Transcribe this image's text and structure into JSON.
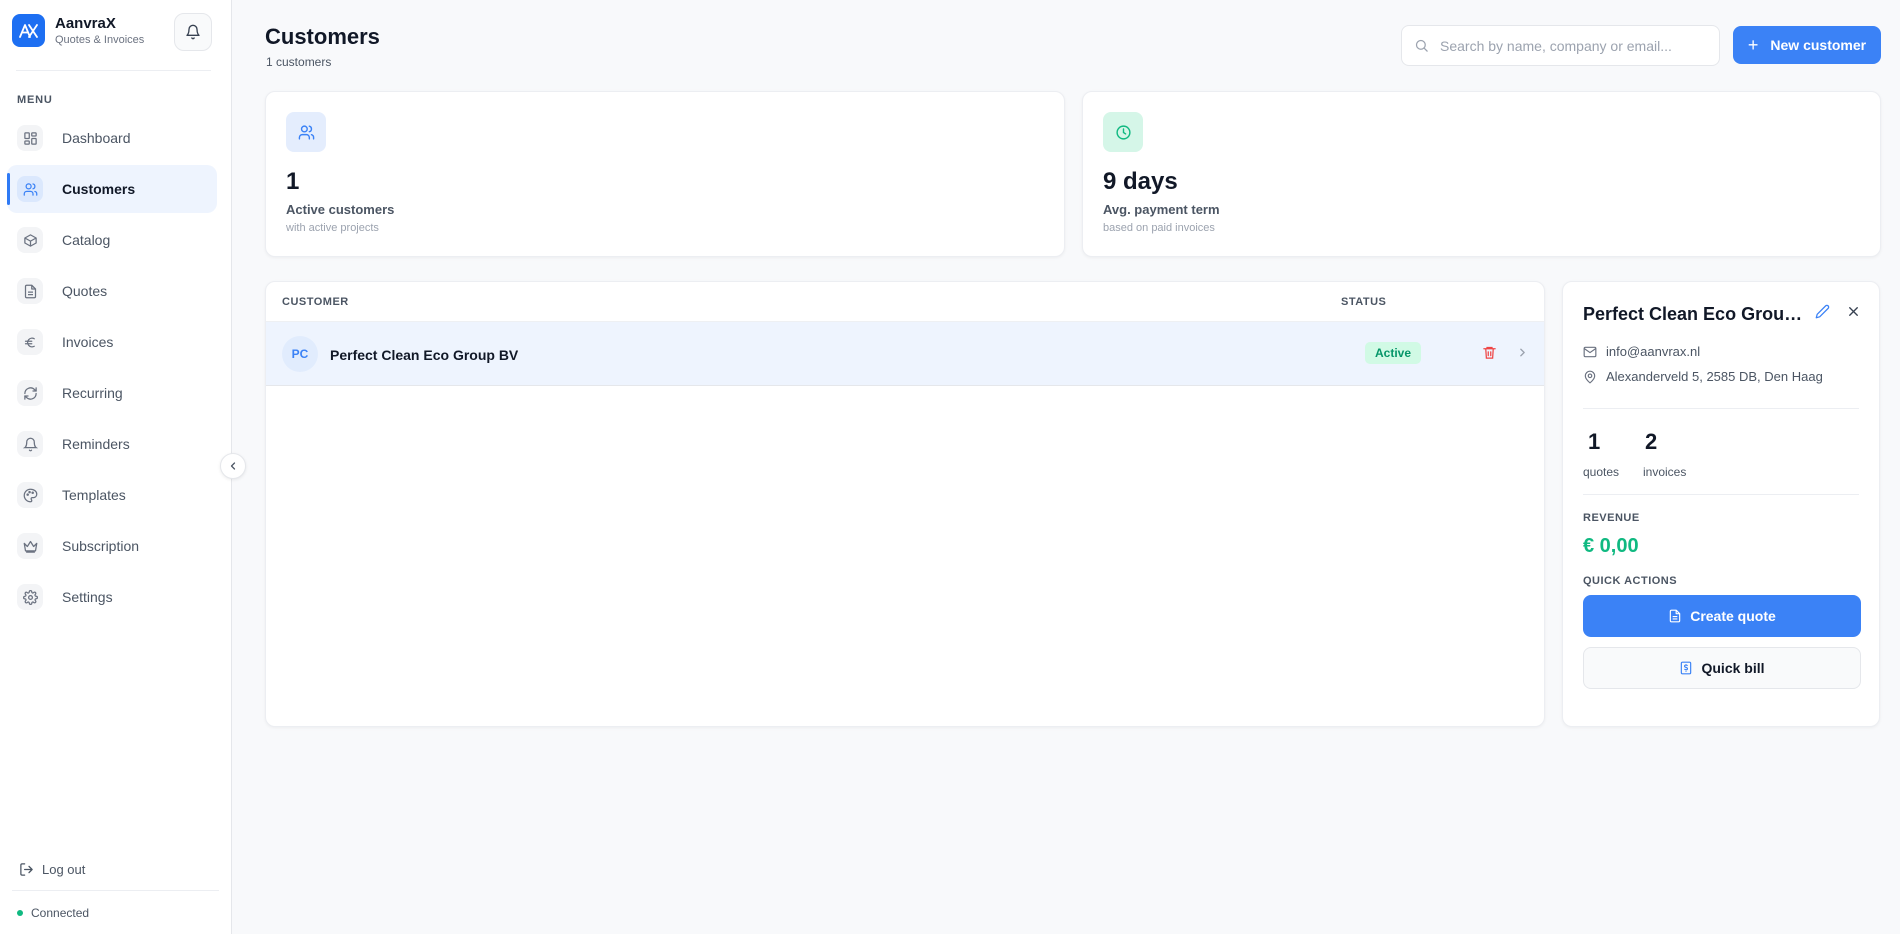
{
  "app": {
    "name": "AanvraX",
    "subtitle": "Quotes & Invoices"
  },
  "colors": {
    "accent": "#3b82f6",
    "success": "#10b981",
    "danger": "#ef4444",
    "active_bg": "#eef4fe"
  },
  "sidebar": {
    "menu_label": "MENU",
    "items": [
      {
        "label": "Dashboard",
        "icon": "dashboard-icon"
      },
      {
        "label": "Customers",
        "icon": "users-icon",
        "active": true
      },
      {
        "label": "Catalog",
        "icon": "box-icon"
      },
      {
        "label": "Quotes",
        "icon": "document-icon"
      },
      {
        "label": "Invoices",
        "icon": "euro-icon"
      },
      {
        "label": "Recurring",
        "icon": "refresh-icon"
      },
      {
        "label": "Reminders",
        "icon": "bell-icon"
      },
      {
        "label": "Templates",
        "icon": "palette-icon"
      },
      {
        "label": "Subscription",
        "icon": "crown-icon"
      },
      {
        "label": "Settings",
        "icon": "gear-icon"
      }
    ],
    "logout_label": "Log out",
    "status_label": "Connected"
  },
  "header": {
    "title": "Customers",
    "subtitle": "1 customers",
    "search_placeholder": "Search by name, company or email...",
    "new_button_label": "New customer"
  },
  "stats": [
    {
      "value": "1",
      "label": "Active customers",
      "sub": "with active projects",
      "icon": "users-icon"
    },
    {
      "value": "9 days",
      "label": "Avg. payment term",
      "sub": "based on paid invoices",
      "icon": "clock-icon"
    }
  ],
  "table": {
    "columns": {
      "customer": "CUSTOMER",
      "status": "STATUS"
    },
    "rows": [
      {
        "initials": "PC",
        "name": "Perfect Clean Eco Group BV",
        "status": "Active"
      }
    ]
  },
  "detail": {
    "title": "Perfect Clean Eco Group BV",
    "email": "info@aanvrax.nl",
    "address": "Alexanderveld 5, 2585 DB, Den Haag",
    "quotes_count": "1",
    "quotes_label": "quotes",
    "invoices_count": "2",
    "invoices_label": "invoices",
    "revenue_label": "REVENUE",
    "revenue_value": "€ 0,00",
    "quick_actions_label": "QUICK ACTIONS",
    "create_quote_label": "Create quote",
    "quick_bill_label": "Quick bill"
  }
}
